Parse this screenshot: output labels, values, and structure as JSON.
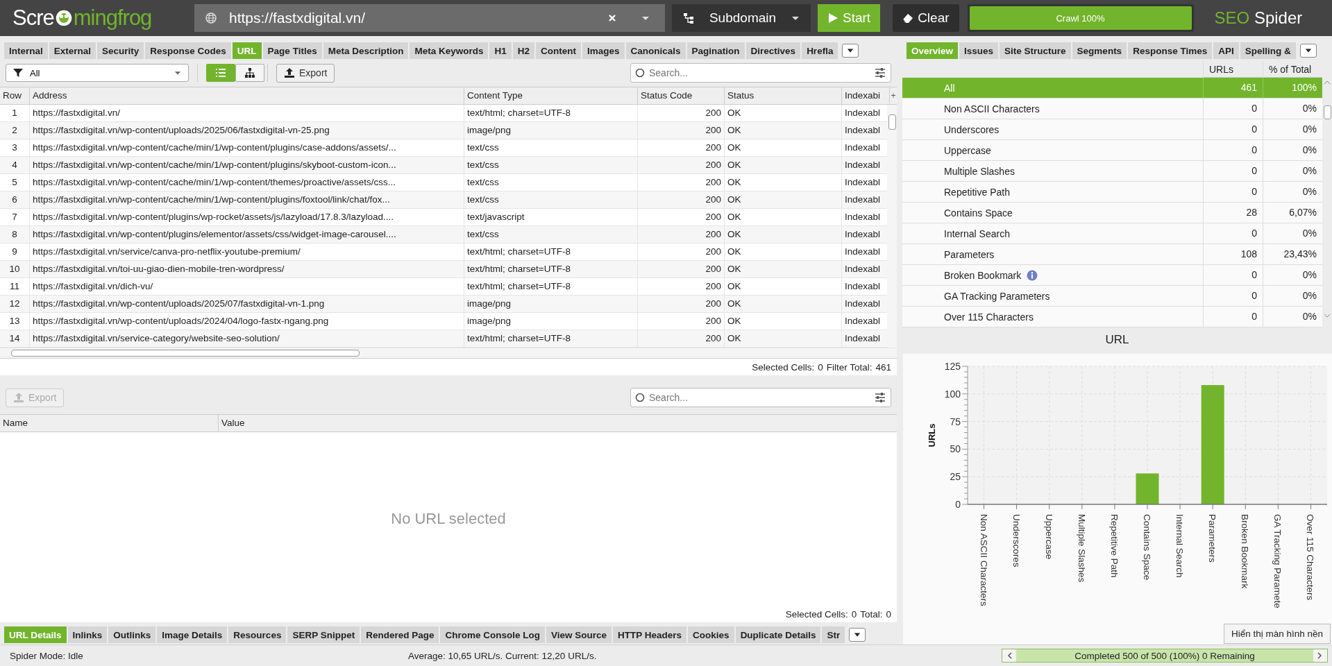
{
  "header": {
    "logo": {
      "before": "Scre",
      "after": "mingfrog"
    },
    "url": "https://fastxdigital.vn/",
    "mode": "Subdomain",
    "start": "Start",
    "clear": "Clear",
    "crawl": {
      "label": "Crawl 100%",
      "level": 1
    },
    "product": {
      "first": "SEO",
      "second": "Spider"
    }
  },
  "main_tabs": [
    {
      "label": "Internal",
      "selected": false
    },
    {
      "label": "External",
      "selected": false
    },
    {
      "label": "Security",
      "selected": false
    },
    {
      "label": "Response Codes",
      "selected": false
    },
    {
      "label": "URL",
      "selected": true
    },
    {
      "label": "Page Titles",
      "selected": false
    },
    {
      "label": "Meta Description",
      "selected": false
    },
    {
      "label": "Meta Keywords",
      "selected": false
    },
    {
      "label": "H1",
      "selected": false
    },
    {
      "label": "H2",
      "selected": false
    },
    {
      "label": "Content",
      "selected": false
    },
    {
      "label": "Images",
      "selected": false
    },
    {
      "label": "Canonicals",
      "selected": false
    },
    {
      "label": "Pagination",
      "selected": false
    },
    {
      "label": "Directives",
      "selected": false
    },
    {
      "label": "Hrefla",
      "selected": false
    }
  ],
  "toolbar": {
    "filter": "All",
    "views": [
      {
        "kind": "list",
        "selected": true
      },
      {
        "kind": "tree",
        "selected": false
      }
    ],
    "export": "Export",
    "search": {
      "placeholder": "Search..."
    }
  },
  "table": {
    "columns": [
      "Row",
      "Address",
      "Content Type",
      "Status Code",
      "Status",
      "Indexabi"
    ],
    "add_column": "+",
    "rows": [
      [
        "1",
        "https://fastxdigital.vn/",
        "text/html; charset=UTF-8",
        "200",
        "OK",
        "Indexabl"
      ],
      [
        "2",
        "https://fastxdigital.vn/wp-content/uploads/2025/06/fastxdigital-vn-25.png",
        "image/png",
        "200",
        "OK",
        "Indexabl"
      ],
      [
        "3",
        "https://fastxdigital.vn/wp-content/cache/min/1/wp-content/plugins/case-addons/assets/...",
        "text/css",
        "200",
        "OK",
        "Indexabl"
      ],
      [
        "4",
        "https://fastxdigital.vn/wp-content/cache/min/1/wp-content/plugins/skyboot-custom-icon...",
        "text/css",
        "200",
        "OK",
        "Indexabl"
      ],
      [
        "5",
        "https://fastxdigital.vn/wp-content/cache/min/1/wp-content/themes/proactive/assets/css...",
        "text/css",
        "200",
        "OK",
        "Indexabl"
      ],
      [
        "6",
        "https://fastxdigital.vn/wp-content/cache/min/1/wp-content/plugins/foxtool/link/chat/fox...",
        "text/css",
        "200",
        "OK",
        "Indexabl"
      ],
      [
        "7",
        "https://fastxdigital.vn/wp-content/plugins/wp-rocket/assets/js/lazyload/17.8.3/lazyload....",
        "text/javascript",
        "200",
        "OK",
        "Indexabl"
      ],
      [
        "8",
        "https://fastxdigital.vn/wp-content/plugins/elementor/assets/css/widget-image-carousel....",
        "text/css",
        "200",
        "OK",
        "Indexabl"
      ],
      [
        "9",
        "https://fastxdigital.vn/service/canva-pro-netflix-youtube-premium/",
        "text/html; charset=UTF-8",
        "200",
        "OK",
        "Indexabl"
      ],
      [
        "10",
        "https://fastxdigital.vn/toi-uu-giao-dien-mobile-tren-wordpress/",
        "text/html; charset=UTF-8",
        "200",
        "OK",
        "Indexabl"
      ],
      [
        "11",
        "https://fastxdigital.vn/dich-vu/",
        "text/html; charset=UTF-8",
        "200",
        "OK",
        "Indexabl"
      ],
      [
        "12",
        "https://fastxdigital.vn/wp-content/uploads/2025/07/fastxdigital-vn-1.png",
        "image/png",
        "200",
        "OK",
        "Indexabl"
      ],
      [
        "13",
        "https://fastxdigital.vn/wp-content/uploads/2024/04/logo-fastx-ngang.png",
        "image/png",
        "200",
        "OK",
        "Indexabl"
      ],
      [
        "14",
        "https://fastxdigital.vn/service-category/website-seo-solution/",
        "text/html; charset=UTF-8",
        "200",
        "OK",
        "Indexabl"
      ]
    ],
    "footer": {
      "selected_label": "Selected Cells:",
      "selected": "0",
      "total_label": "Filter Total:",
      "total": "461"
    }
  },
  "details": {
    "export": "Export",
    "search": {
      "placeholder": "Search..."
    },
    "columns": [
      "Name",
      "Value"
    ],
    "empty": "No URL selected",
    "footer": {
      "selected_label": "Selected Cells:",
      "selected": "0",
      "total_label": "Total:",
      "total": "0"
    }
  },
  "bottom_tabs": [
    {
      "label": "URL Details",
      "selected": true
    },
    {
      "label": "Inlinks",
      "selected": false
    },
    {
      "label": "Outlinks",
      "selected": false
    },
    {
      "label": "Image Details",
      "selected": false
    },
    {
      "label": "Resources",
      "selected": false
    },
    {
      "label": "SERP Snippet",
      "selected": false
    },
    {
      "label": "Rendered Page",
      "selected": false
    },
    {
      "label": "Chrome Console Log",
      "selected": false
    },
    {
      "label": "View Source",
      "selected": false
    },
    {
      "label": "HTTP Headers",
      "selected": false
    },
    {
      "label": "Cookies",
      "selected": false
    },
    {
      "label": "Duplicate Details",
      "selected": false
    },
    {
      "label": "Str",
      "selected": false
    }
  ],
  "side_tabs": [
    {
      "label": "Overview",
      "selected": true
    },
    {
      "label": "Issues",
      "selected": false
    },
    {
      "label": "Site Structure",
      "selected": false
    },
    {
      "label": "Segments",
      "selected": false
    },
    {
      "label": "Response Times",
      "selected": false
    },
    {
      "label": "API",
      "selected": false
    },
    {
      "label": "Spelling &",
      "selected": false
    }
  ],
  "overview": {
    "columns": [
      "URLs",
      "% of Total"
    ],
    "rows": [
      {
        "label": "All",
        "urls": "461",
        "percent": "100%",
        "selected": true
      },
      {
        "label": "Non ASCII Characters",
        "urls": "0",
        "percent": "0%",
        "selected": false
      },
      {
        "label": "Underscores",
        "urls": "0",
        "percent": "0%",
        "selected": false
      },
      {
        "label": "Uppercase",
        "urls": "0",
        "percent": "0%",
        "selected": false
      },
      {
        "label": "Multiple Slashes",
        "urls": "0",
        "percent": "0%",
        "selected": false
      },
      {
        "label": "Repetitive Path",
        "urls": "0",
        "percent": "0%",
        "selected": false
      },
      {
        "label": "Contains Space",
        "urls": "28",
        "percent": "6,07%",
        "selected": false
      },
      {
        "label": "Internal Search",
        "urls": "0",
        "percent": "0%",
        "selected": false
      },
      {
        "label": "Parameters",
        "urls": "108",
        "percent": "23,43%",
        "selected": false
      },
      {
        "label": "Broken Bookmark",
        "urls": "0",
        "percent": "0%",
        "selected": false,
        "info": true
      },
      {
        "label": "GA Tracking Parameters",
        "urls": "0",
        "percent": "0%",
        "selected": false
      },
      {
        "label": "Over 115 Characters",
        "urls": "0",
        "percent": "0%",
        "selected": false
      }
    ]
  },
  "chart_data": {
    "type": "bar",
    "title": "URL",
    "ylabel": "URLs",
    "categories": [
      "Non ASCII Characters",
      "Underscores",
      "Uppercase",
      "Multiple Slashes",
      "Repetitive Path",
      "Contains Space",
      "Internal Search",
      "Parameters",
      "Broken Bookmark",
      "GA Tracking Paramete",
      "Over 115 Characters"
    ],
    "series": [
      {
        "color": "#72b52c",
        "values": [
          0,
          0,
          0,
          0,
          0,
          28,
          0,
          108,
          0,
          0,
          0
        ]
      }
    ],
    "ylim": [
      0,
      125
    ],
    "grid": true,
    "yticks": [
      0,
      25,
      50,
      75,
      100,
      125
    ]
  },
  "status_bar": {
    "mode": "Spider Mode: Idle",
    "speed": "Average: 10,65 URL/s. Current: 12,20 URL/s.",
    "progress": {
      "label": "Completed 500 of 500 (100%) 0 Remaining",
      "level": 1
    }
  },
  "tooltip": "Hiển thị màn hình nền"
}
